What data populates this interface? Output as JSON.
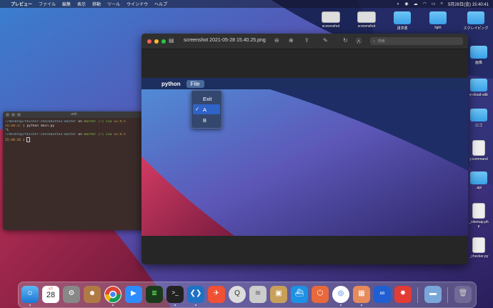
{
  "menubar": {
    "apple": "",
    "app_name": "プレビュー",
    "items": [
      "ファイル",
      "編集",
      "表示",
      "移動",
      "ツール",
      "ウインドウ",
      "ヘルプ"
    ],
    "clock": "5月28日(金) 15:40:41"
  },
  "desktop_icons": [
    {
      "label": "screenshot",
      "kind": "shot"
    },
    {
      "label": "screenshot",
      "kind": "shot"
    },
    {
      "label": "請求書",
      "kind": "folder"
    },
    {
      "label": "light",
      "kind": "folder"
    },
    {
      "label": "スクレイピング",
      "kind": "folder"
    },
    {
      "label": "画像",
      "kind": "folder"
    },
    {
      "label": "e-cloud-sdk",
      "kind": "folder"
    },
    {
      "label": "ロゴ",
      "kind": "folder"
    },
    {
      "label": "y.command",
      "kind": "doc"
    },
    {
      "label": ".api",
      "kind": "folder"
    },
    {
      "label": "_sitemap.ph\np",
      "kind": "doc"
    },
    {
      "label": "_checker.py",
      "kind": "doc"
    }
  ],
  "terminal": {
    "title": "-zsh",
    "lines": [
      {
        "path": "~/desktop/tkinter-checkbutton-master",
        "rest": " on ",
        "branch": "master [!] via ",
        "py": "v3.9.5"
      },
      {
        "time": "15:40:17",
        "cmd": " python main.py"
      },
      {
        "plain": "^C"
      },
      {
        "path": "~/desktop/tkinter-checkbutton-master",
        "rest": " on ",
        "branch": "master [!] via ",
        "py": "v3.9.5"
      },
      {
        "time": "15:40:26",
        "cmd": " "
      }
    ]
  },
  "preview": {
    "title": "screenshot 2021-05-28 15.40.25.png",
    "search_placeholder": "検索",
    "app_menu": {
      "apple": "",
      "app_name": "python",
      "file_label": "File"
    },
    "dropdown": {
      "items": [
        {
          "label": "Exit",
          "checked": false,
          "selected": false
        },
        {
          "label": "A",
          "checked": true,
          "selected": true
        },
        {
          "label": "B",
          "checked": false,
          "selected": false
        }
      ],
      "check_glyph": "✓"
    }
  },
  "dock": {
    "calendar_month": "5月",
    "calendar_day": "28"
  },
  "colors": {
    "accent": "#2f63c8",
    "menu_bg": "#34476e",
    "app_bar": "#1c2f5e"
  }
}
